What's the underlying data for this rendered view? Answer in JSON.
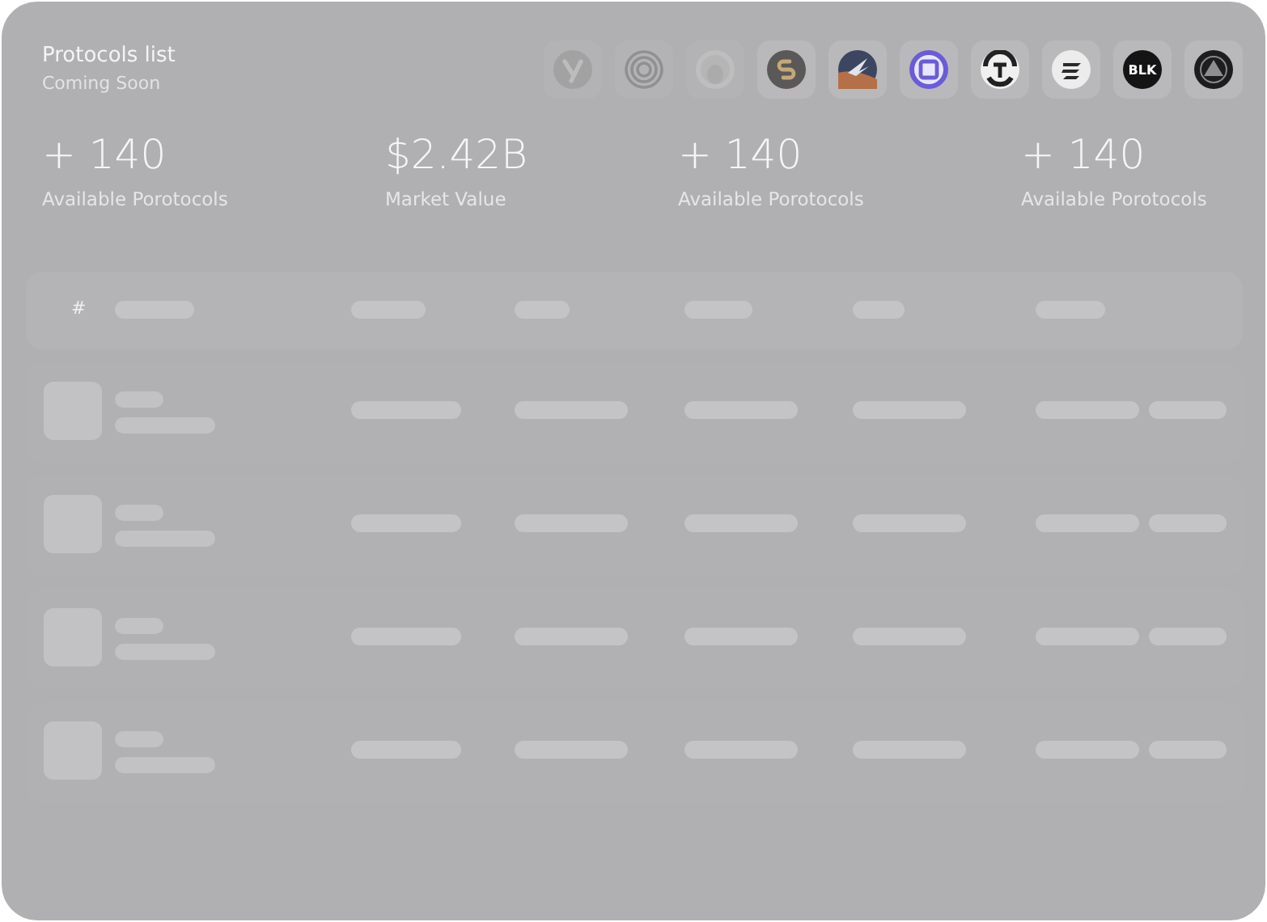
{
  "header": {
    "title": "Protocols list",
    "subtitle": "Coming Soon"
  },
  "logos": [
    {
      "kind": "y",
      "dimmed": true
    },
    {
      "kind": "rings",
      "dimmed": true
    },
    {
      "kind": "portrait",
      "dimmed": true
    },
    {
      "kind": "link",
      "dimmed": false
    },
    {
      "kind": "wing",
      "dimmed": false
    },
    {
      "kind": "square",
      "dimmed": false
    },
    {
      "kind": "t",
      "dimmed": false
    },
    {
      "kind": "stripes",
      "dimmed": false
    },
    {
      "kind": "text",
      "text": "BLK",
      "dimmed": false
    },
    {
      "kind": "triangle",
      "dimmed": false
    }
  ],
  "stats": [
    {
      "value": "+ 140",
      "label": "Available Porotocols"
    },
    {
      "value": "$2.42B",
      "label": "Market Value"
    },
    {
      "value": "+ 140",
      "label": "Available Porotocols"
    },
    {
      "value": "+ 140",
      "label": "Available Porotocols"
    }
  ],
  "table": {
    "index_header": "#",
    "rows": [
      {
        "kind": "skeleton"
      },
      {
        "kind": "skeleton"
      },
      {
        "kind": "skeleton"
      },
      {
        "kind": "skeleton"
      }
    ]
  }
}
